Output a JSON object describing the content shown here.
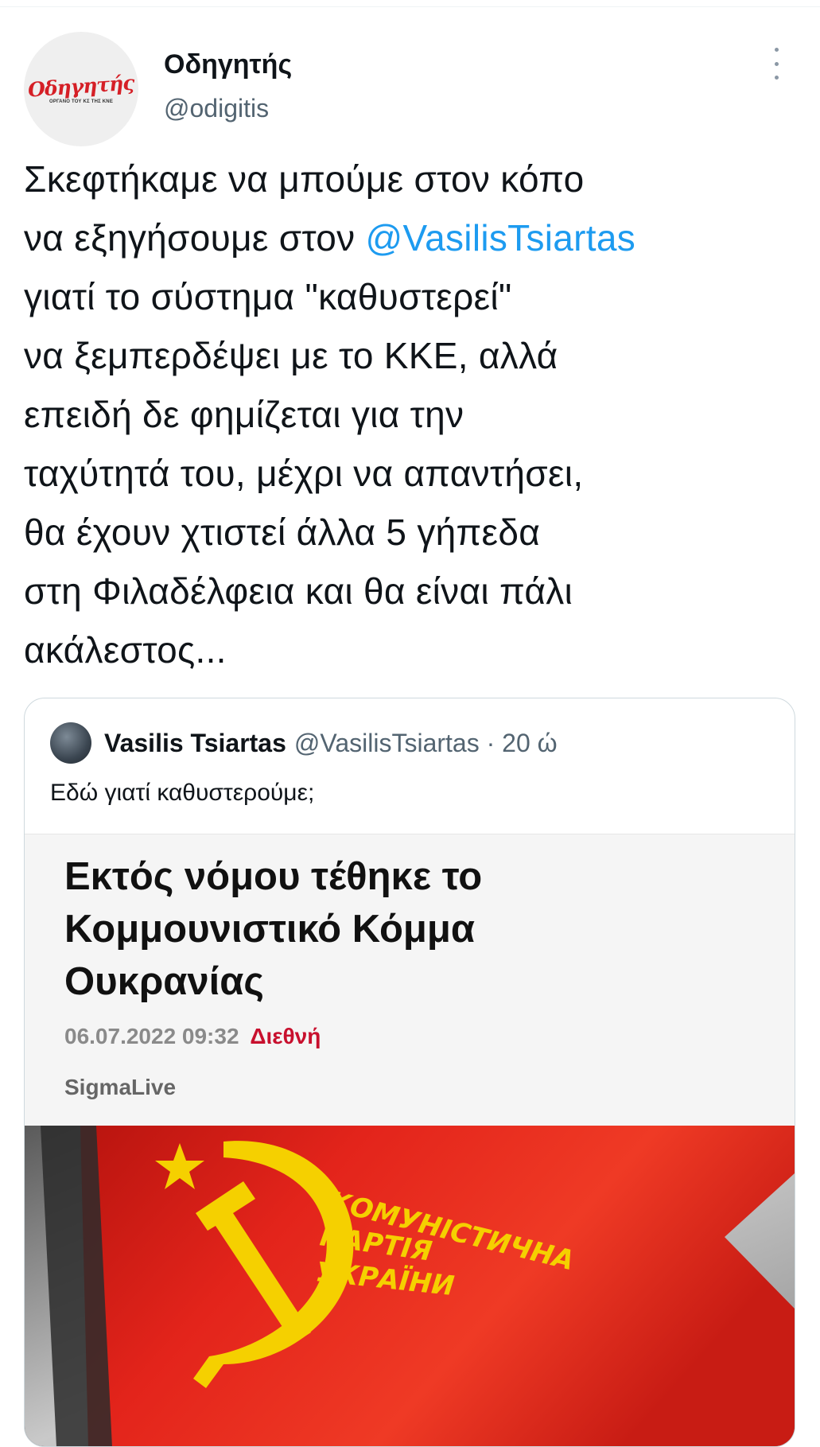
{
  "tweet": {
    "author": {
      "display_name": "Οδηγητής",
      "handle": "@odigitis",
      "avatar": {
        "logo_text": "Οδηγητής",
        "logo_subtitle": "ΟΡΓΑΝΟ ΤΟΥ ΚΣ ΤΗΣ ΚΝΕ"
      }
    },
    "more_icon": "vertical-ellipsis-icon",
    "text_lines": [
      "Σκεφτήκαμε να μπούμε στον κόπο",
      "να εξηγήσουμε στον ",
      "γιατί το σύστημα \"καθυστερεί\"",
      "να ξεμπερδέψει με το ΚΚΕ, αλλά",
      "επειδή δε φημίζεται για την",
      "ταχύτητά του, μέχρι να απαντήσει,",
      "θα έχουν χτιστεί άλλα 5 γήπεδα",
      "στη Φιλαδέλφεια και θα είναι πάλι",
      "ακάλεστος..."
    ],
    "mention": "@VasilisTsiartas",
    "mention_color": "#1d9bf0"
  },
  "quoted_tweet": {
    "author_name": "Vasilis Tsiartas",
    "author_handle": "@VasilisTsiartas · 20 ώ",
    "text": "Εδώ γιατί καθυστερούμε;",
    "article": {
      "title_lines": [
        "Εκτός νόμου τέθηκε το",
        "Κομμουνιστικό Κόμμα",
        "Ουκρανίας"
      ],
      "date": "06.07.2022 09:32",
      "category": "Διεθνή",
      "category_color": "#c8102e",
      "source": "SigmaLive",
      "image": {
        "flag_text": [
          "КОМУНІСТИЧНА",
          "ПАРТІЯ",
          "УКРАЇНИ"
        ],
        "flag_color": "#e3241b",
        "emblem_color": "#f5d000"
      }
    }
  }
}
